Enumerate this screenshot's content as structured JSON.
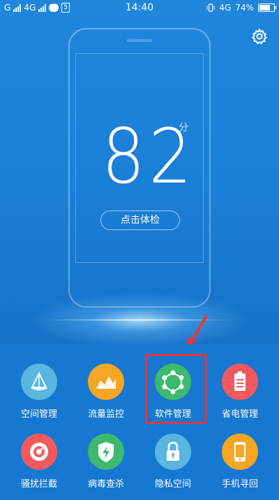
{
  "status_bar": {
    "left_text_1": "G",
    "left_text_2": "4G",
    "box_text": "5",
    "time": "14:40",
    "network": "4G",
    "battery_percent": "74%"
  },
  "icons": {
    "settings": "gear-icon"
  },
  "score": {
    "value": "82",
    "unit": "分",
    "check_button": "点击体检"
  },
  "tools": [
    {
      "label": "空间管理",
      "color": "#58b6e0",
      "icon": "space-manage-icon"
    },
    {
      "label": "流量监控",
      "color": "#f5a623",
      "icon": "traffic-monitor-icon"
    },
    {
      "label": "软件管理",
      "color": "#3cba6f",
      "icon": "software-manage-icon"
    },
    {
      "label": "省电管理",
      "color": "#f05a5f",
      "icon": "battery-save-icon"
    },
    {
      "label": "骚扰拦截",
      "color": "#f05a5f",
      "icon": "harass-block-icon"
    },
    {
      "label": "病毒查杀",
      "color": "#3cba6f",
      "icon": "virus-scan-icon"
    },
    {
      "label": "隐私空间",
      "color": "#58b6e0",
      "icon": "privacy-space-icon"
    },
    {
      "label": "手机寻回",
      "color": "#f5a623",
      "icon": "phone-find-icon"
    }
  ]
}
